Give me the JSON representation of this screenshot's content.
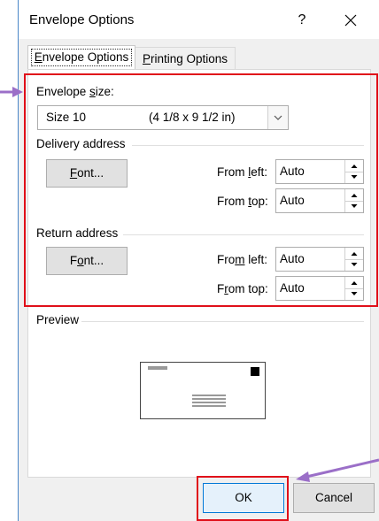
{
  "window": {
    "title": "Envelope Options",
    "help": "?",
    "close": "✕"
  },
  "tabs": [
    {
      "label_pre": "",
      "label_key": "E",
      "label_post": "nvelope Options"
    },
    {
      "label_pre": "",
      "label_key": "P",
      "label_post": "rinting Options"
    }
  ],
  "envelope_size": {
    "label_pre": "Envelope ",
    "label_key": "s",
    "label_post": "ize:",
    "selected_name": "Size 10",
    "selected_dims": "(4 1/8 x 9 1/2 in)"
  },
  "delivery": {
    "heading": "Delivery address",
    "font_pre": "",
    "font_key": "F",
    "font_post": "ont...",
    "left_pre": "From ",
    "left_key": "l",
    "left_post": "eft:",
    "left_value": "Auto",
    "top_pre": "From ",
    "top_key": "t",
    "top_post": "op:",
    "top_value": "Auto"
  },
  "return": {
    "heading": "Return address",
    "font_pre": "F",
    "font_key": "o",
    "font_post": "nt...",
    "left_pre": "Fro",
    "left_key": "m",
    "left_post": " left:",
    "left_value": "Auto",
    "top_pre": "F",
    "top_key": "r",
    "top_post": "om top:",
    "top_value": "Auto"
  },
  "preview": {
    "heading": "Preview"
  },
  "footer": {
    "ok": "OK",
    "cancel": "Cancel"
  },
  "colors": {
    "highlight": "#e0101a",
    "arrow": "#9b6fc8",
    "button_primary_bg": "#e5f1fb",
    "button_primary_border": "#0078d7"
  }
}
